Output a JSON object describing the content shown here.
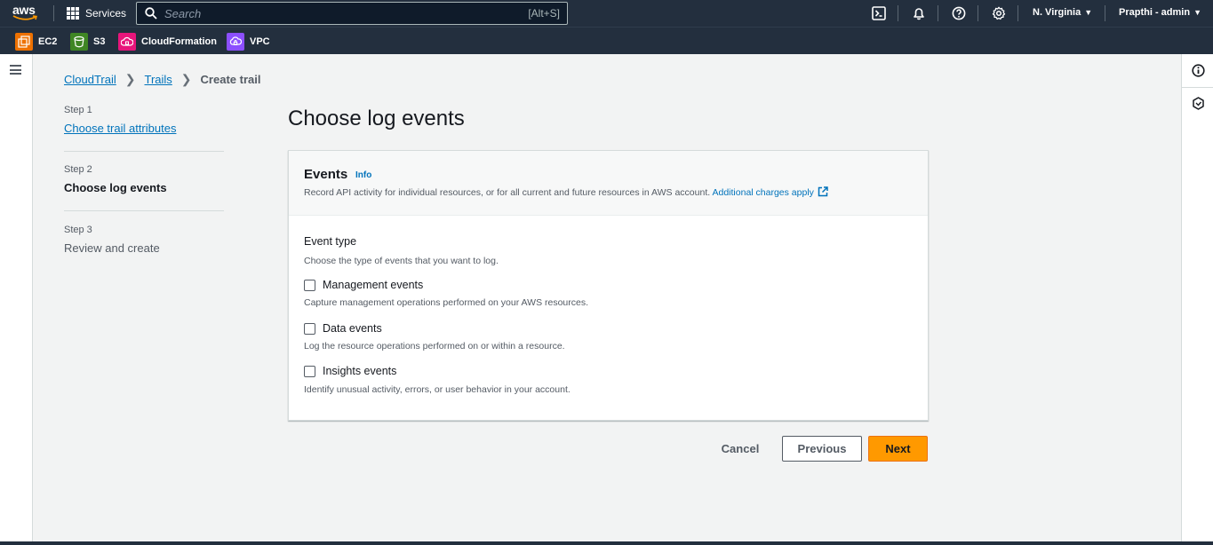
{
  "topnav": {
    "logo_text": "aws",
    "services_label": "Services",
    "search_placeholder": "Search",
    "search_shortcut": "[Alt+S]",
    "region": "N. Virginia",
    "account": "Prapthi - admin",
    "icons": [
      "cloudshell-icon",
      "bell-icon",
      "help-icon",
      "settings-icon"
    ]
  },
  "favorites": [
    {
      "label": "EC2",
      "color": "#ed7100",
      "icon": "ec2-icon"
    },
    {
      "label": "S3",
      "color": "#3f8624",
      "icon": "s3-icon"
    },
    {
      "label": "CloudFormation",
      "color": "#e7157b",
      "icon": "cloudformation-icon"
    },
    {
      "label": "VPC",
      "color": "#8c4fff",
      "icon": "vpc-icon"
    }
  ],
  "breadcrumb": [
    "CloudTrail",
    "Trails",
    "Create trail"
  ],
  "steps": [
    {
      "num": "Step 1",
      "title": "Choose trail attributes",
      "state": "link"
    },
    {
      "num": "Step 2",
      "title": "Choose log events",
      "state": "active"
    },
    {
      "num": "Step 3",
      "title": "Review and create",
      "state": "disabled"
    }
  ],
  "page_title": "Choose log events",
  "panel": {
    "title": "Events",
    "info": "Info",
    "description": "Record API activity for individual resources, or for all current and future resources in AWS account.",
    "charges_link": "Additional charges apply",
    "field_label": "Event type",
    "field_desc": "Choose the type of events that you want to log.",
    "options": [
      {
        "label": "Management events",
        "desc": "Capture management operations performed on your AWS resources.",
        "checked": false
      },
      {
        "label": "Data events",
        "desc": "Log the resource operations performed on or within a resource.",
        "checked": false
      },
      {
        "label": "Insights events",
        "desc": "Identify unusual activity, errors, or user behavior in your account.",
        "checked": false
      }
    ]
  },
  "actions": {
    "cancel": "Cancel",
    "previous": "Previous",
    "next": "Next"
  },
  "colors": {
    "accent": "#0073bb",
    "primary_button": "#ff9900",
    "nav_bg": "#232f3e"
  }
}
